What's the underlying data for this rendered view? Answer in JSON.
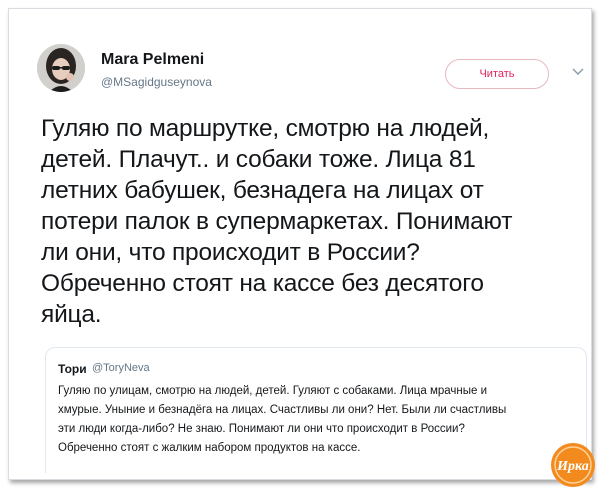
{
  "author": {
    "name": "Mara Pelmeni",
    "handle": "@MSagidguseynova"
  },
  "follow_button": {
    "label": "Читать"
  },
  "tweet": {
    "lines": [
      "Гуляю по маршрутке, смотрю на людей,",
      "детей. Плачут.. и собаки тоже. Лица 81",
      "летних бабушек, безнадега на лицах от",
      "потери палок в супермаркетах. Понимают",
      "ли они, что происходит в России?",
      "Обреченно стоят на кассе без десятого",
      "яйца."
    ]
  },
  "quoted_tweet": {
    "name": "Тори",
    "handle": "@ToryNeva",
    "lines": [
      "Гуляю по улицам, смотрю на людей, детей. Гуляют с собаками. Лица мрачные и",
      "хмурые. Уныние и безнадёга на лицах. Счастливы ли они? Нет. Были ли счастливы",
      "эти люди когда-либо? Не знаю. Понимают ли они что происходит в России?",
      "Обреченно стоят с жалким набором продуктов на кассе."
    ]
  },
  "watermark": {
    "text": "Ирка"
  },
  "colors": {
    "follow_accent": "#e0245e",
    "handle_gray": "#657786",
    "text": "#14171a",
    "watermark_orange": "#f28a1e"
  },
  "icons": {
    "chevron": "chevron-down-icon"
  }
}
